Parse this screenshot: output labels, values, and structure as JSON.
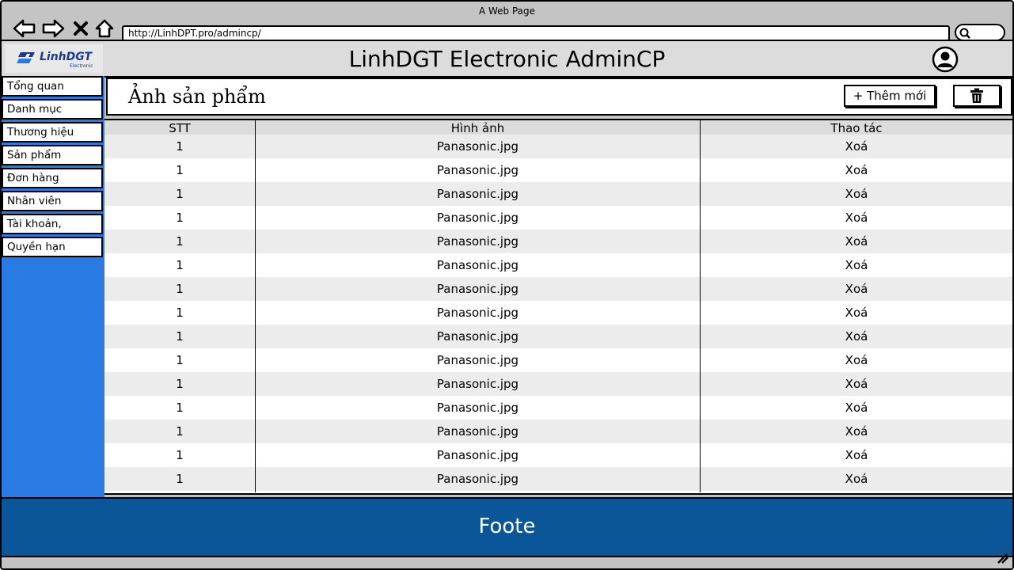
{
  "browser": {
    "title": "A Web Page",
    "url": "http://LinhDPT.pro/admincp/"
  },
  "header": {
    "logo_text": "LinhDGT",
    "logo_sub": "Electronic",
    "title": "LinhDGT Electronic AdminCP"
  },
  "sidebar": {
    "items": [
      {
        "label": "Tổng quan"
      },
      {
        "label": "Danh mục"
      },
      {
        "label": "Thương hiệu"
      },
      {
        "label": "Sản phẩm"
      },
      {
        "label": "Đơn hàng"
      },
      {
        "label": "Nhân viên"
      },
      {
        "label": "Tài khoản,"
      },
      {
        "label": "Quyền hạn"
      }
    ]
  },
  "section": {
    "title": "Ảnh sản phẩm",
    "add_label": "+ Thêm mới"
  },
  "table": {
    "columns": [
      "STT",
      "Hình ảnh",
      "Thao tác"
    ],
    "rows": [
      {
        "stt": "1",
        "image": "Panasonic.jpg",
        "action": "Xoá"
      },
      {
        "stt": "1",
        "image": "Panasonic.jpg",
        "action": "Xoá"
      },
      {
        "stt": "1",
        "image": "Panasonic.jpg",
        "action": "Xoá"
      },
      {
        "stt": "1",
        "image": "Panasonic.jpg",
        "action": "Xoá"
      },
      {
        "stt": "1",
        "image": "Panasonic.jpg",
        "action": "Xoá"
      },
      {
        "stt": "1",
        "image": "Panasonic.jpg",
        "action": "Xoá"
      },
      {
        "stt": "1",
        "image": "Panasonic.jpg",
        "action": "Xoá"
      },
      {
        "stt": "1",
        "image": "Panasonic.jpg",
        "action": "Xoá"
      },
      {
        "stt": "1",
        "image": "Panasonic.jpg",
        "action": "Xoá"
      },
      {
        "stt": "1",
        "image": "Panasonic.jpg",
        "action": "Xoá"
      },
      {
        "stt": "1",
        "image": "Panasonic.jpg",
        "action": "Xoá"
      },
      {
        "stt": "1",
        "image": "Panasonic.jpg",
        "action": "Xoá"
      },
      {
        "stt": "1",
        "image": "Panasonic.jpg",
        "action": "Xoá"
      },
      {
        "stt": "1",
        "image": "Panasonic.jpg",
        "action": "Xoá"
      },
      {
        "stt": "1",
        "image": "Panasonic.jpg",
        "action": "Xoá"
      }
    ]
  },
  "footer": {
    "text": "Foote"
  },
  "colors": {
    "sidebar": "#2a7ae4",
    "footer": "#0a5699",
    "chrome": "#c4c4c4",
    "row_alt": "#ececec"
  },
  "icons": [
    "back-arrow-icon",
    "forward-arrow-icon",
    "close-icon",
    "home-icon",
    "search-icon",
    "user-icon",
    "trash-icon",
    "resize-grip-icon"
  ]
}
